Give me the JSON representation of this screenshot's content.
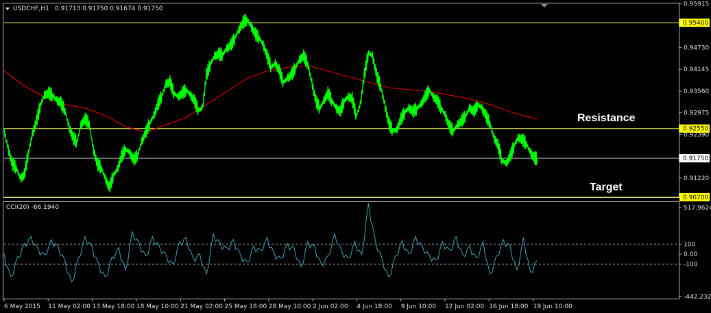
{
  "header": {
    "symbol": "USDCHF,H1",
    "ohlc": "0.91713 0.91750 0.91674 0.91750"
  },
  "indicator": {
    "label": "CCI(20) -66.1940"
  },
  "colors": {
    "background": "#000000",
    "price": "#00ff00",
    "ma": "#ff0000",
    "cci": "#3fa7b3",
    "level_line": "#ffff66",
    "current_line": "#aeb8c8",
    "frame": "#c0c0c0",
    "tag_bg": "#ffff00"
  },
  "chart_data": [
    {
      "type": "line",
      "title": "USDCHF,H1",
      "x_ticks": [
        "6 May 2015",
        "11 May 02:00",
        "13 May 18:00",
        "18 May 10:00",
        "21 May 02:00",
        "25 May 18:00",
        "28 May 10:00",
        "2 Jun 02:00",
        "4 Jun 18:00",
        "9 Jun 10:00",
        "12 Jun 02:00",
        "16 Jun 18:00",
        "19 Jun 10:00"
      ],
      "y_ticks": [
        0.95915,
        0.9473,
        0.94145,
        0.9356,
        0.92975,
        0.9239,
        0.9122
      ],
      "ylim": [
        0.907,
        0.9592
      ],
      "series": [
        {
          "kind": "price",
          "x": [
            0,
            6,
            12,
            18,
            24,
            30,
            36,
            42,
            48,
            54,
            60,
            66,
            72,
            78,
            84,
            90,
            96,
            102,
            108,
            114,
            120,
            126,
            132,
            138,
            144,
            150,
            156,
            162,
            168,
            174,
            180,
            186,
            192,
            198,
            204,
            210,
            216,
            222,
            228,
            234,
            240,
            246,
            252,
            258,
            264,
            270,
            276,
            282,
            288,
            294,
            300,
            306,
            312,
            318,
            324,
            330,
            336,
            342,
            348,
            354,
            360,
            366,
            372,
            378,
            384,
            390,
            396,
            402,
            408,
            414,
            420,
            426,
            432,
            438,
            444,
            450,
            456,
            462,
            468,
            474,
            480,
            486,
            492,
            498,
            504,
            510,
            516,
            522,
            528,
            534,
            540,
            546,
            552,
            558,
            564,
            570,
            576,
            582,
            588,
            594,
            600,
            606,
            612,
            618,
            624,
            630,
            636,
            642,
            648,
            654,
            660,
            666,
            672,
            678,
            684,
            690,
            696,
            702,
            708,
            714,
            720,
            726,
            732,
            738,
            744,
            750,
            756,
            762,
            768,
            774,
            780,
            786,
            790
          ],
          "values": [
            0.925,
            0.92,
            0.916,
            0.915,
            0.912,
            0.913,
            0.919,
            0.924,
            0.9275,
            0.932,
            0.9345,
            0.935,
            0.9345,
            0.933,
            0.9325,
            0.9305,
            0.926,
            0.923,
            0.922,
            0.9265,
            0.928,
            0.927,
            0.92,
            0.916,
            0.915,
            0.912,
            0.9095,
            0.913,
            0.9145,
            0.918,
            0.92,
            0.919,
            0.917,
            0.9185,
            0.922,
            0.9245,
            0.927,
            0.929,
            0.932,
            0.9345,
            0.9375,
            0.938,
            0.935,
            0.934,
            0.935,
            0.936,
            0.9345,
            0.933,
            0.9305,
            0.931,
            0.94,
            0.943,
            0.945,
            0.9455,
            0.9455,
            0.947,
            0.948,
            0.95,
            0.952,
            0.954,
            0.955,
            0.953,
            0.951,
            0.95,
            0.948,
            0.945,
            0.942,
            0.943,
            0.941,
            0.938,
            0.939,
            0.94,
            0.942,
            0.944,
            0.945,
            0.943,
            0.938,
            0.933,
            0.931,
            0.933,
            0.935,
            0.933,
            0.931,
            0.93,
            0.933,
            0.934,
            0.9335,
            0.929,
            0.932,
            0.94,
            0.946,
            0.945,
            0.94,
            0.937,
            0.932,
            0.927,
            0.925,
            0.925,
            0.928,
            0.93,
            0.931,
            0.93,
            0.931,
            0.932,
            0.934,
            0.936,
            0.934,
            0.933,
            0.931,
            0.929,
            0.926,
            0.925,
            0.9265,
            0.9275,
            0.929,
            0.931,
            0.93,
            0.932,
            0.931,
            0.929,
            0.927,
            0.923,
            0.921,
            0.917,
            0.916,
            0.918,
            0.921,
            0.923,
            0.9225,
            0.9215,
            0.919,
            0.9175,
            0.9175
          ]
        },
        {
          "kind": "ma",
          "x": [
            0,
            30,
            60,
            90,
            120,
            150,
            180,
            210,
            240,
            270,
            300,
            330,
            360,
            390,
            420,
            450,
            480,
            510,
            540,
            570,
            600,
            630,
            660,
            690,
            720,
            750,
            770,
            790
          ],
          "values": [
            0.941,
            0.937,
            0.934,
            0.932,
            0.931,
            0.929,
            0.926,
            0.9245,
            0.9265,
            0.9285,
            0.932,
            0.9355,
            0.939,
            0.941,
            0.942,
            0.9425,
            0.941,
            0.9395,
            0.938,
            0.9365,
            0.936,
            0.9355,
            0.9345,
            0.9335,
            0.932,
            0.93,
            0.929,
            0.928
          ]
        }
      ],
      "levels": [
        {
          "value": 0.954,
          "tag": "0.95400"
        },
        {
          "value": 0.9255,
          "tag": "0.92550"
        },
        {
          "value": 0.9175,
          "tag": "0.91750"
        },
        {
          "value": 0.907,
          "tag": "0.90700"
        }
      ],
      "annotations": [
        "Resistance",
        "Target"
      ]
    },
    {
      "type": "line",
      "title": "CCI(20) -66.1940",
      "y_ticks": [
        "517.9624",
        "100",
        "0.00",
        "-100",
        "-442.2327"
      ],
      "y_tick_values": [
        517.9624,
        100,
        0,
        -100,
        -442.2327
      ],
      "ylim": [
        -442.2327,
        517.9624
      ],
      "dashed_levels": [
        100,
        -100
      ],
      "series": [
        {
          "kind": "cci",
          "x": [
            0,
            10,
            20,
            30,
            40,
            50,
            60,
            70,
            80,
            90,
            100,
            110,
            120,
            130,
            140,
            150,
            160,
            170,
            180,
            190,
            200,
            210,
            220,
            230,
            240,
            250,
            260,
            270,
            280,
            290,
            300,
            310,
            320,
            330,
            340,
            350,
            360,
            370,
            380,
            390,
            400,
            410,
            420,
            430,
            440,
            450,
            460,
            470,
            480,
            490,
            500,
            510,
            520,
            530,
            540,
            550,
            560,
            570,
            580,
            590,
            600,
            610,
            620,
            630,
            640,
            650,
            660,
            670,
            680,
            690,
            700,
            710,
            720,
            730,
            740,
            750,
            760,
            770,
            780,
            790
          ],
          "values": [
            -20,
            -250,
            -50,
            80,
            150,
            40,
            -30,
            120,
            60,
            -80,
            -300,
            -60,
            150,
            60,
            -120,
            -250,
            -50,
            40,
            -180,
            200,
            90,
            -40,
            150,
            60,
            -30,
            -120,
            100,
            140,
            -60,
            -20,
            -220,
            180,
            90,
            40,
            120,
            -20,
            -100,
            60,
            20,
            140,
            -10,
            -60,
            80,
            40,
            -150,
            100,
            60,
            -120,
            -40,
            180,
            20,
            -60,
            100,
            -30,
            480,
            120,
            -60,
            -250,
            -40,
            110,
            -20,
            150,
            60,
            -30,
            -80,
            100,
            20,
            150,
            -30,
            60,
            -60,
            100,
            -220,
            -40,
            120,
            60,
            -180,
            140,
            -200,
            -66
          ]
        }
      ]
    }
  ]
}
